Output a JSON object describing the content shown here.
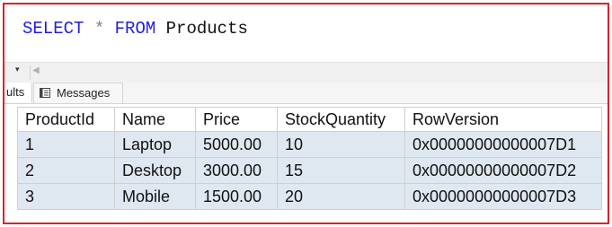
{
  "editor": {
    "keyword_select": "SELECT",
    "star": "*",
    "keyword_from": "FROM",
    "table_name": "Products"
  },
  "scrollbar": {
    "zoom_arrow": "▾",
    "left_arrow": "◀"
  },
  "tabs": {
    "results": "ults",
    "messages": "Messages"
  },
  "grid": {
    "columns": [
      "ProductId",
      "Name",
      "Price",
      "StockQuantity",
      "RowVersion"
    ],
    "rows": [
      [
        "1",
        "Laptop",
        "5000.00",
        "10",
        "0x00000000000007D1"
      ],
      [
        "2",
        "Desktop",
        "3000.00",
        "15",
        "0x00000000000007D2"
      ],
      [
        "3",
        "Mobile",
        "1500.00",
        "20",
        "0x00000000000007D3"
      ]
    ]
  },
  "colors": {
    "frame_border": "#e0202a",
    "keyword": "#1f1fdc",
    "row_background": "#dfe8f1"
  }
}
